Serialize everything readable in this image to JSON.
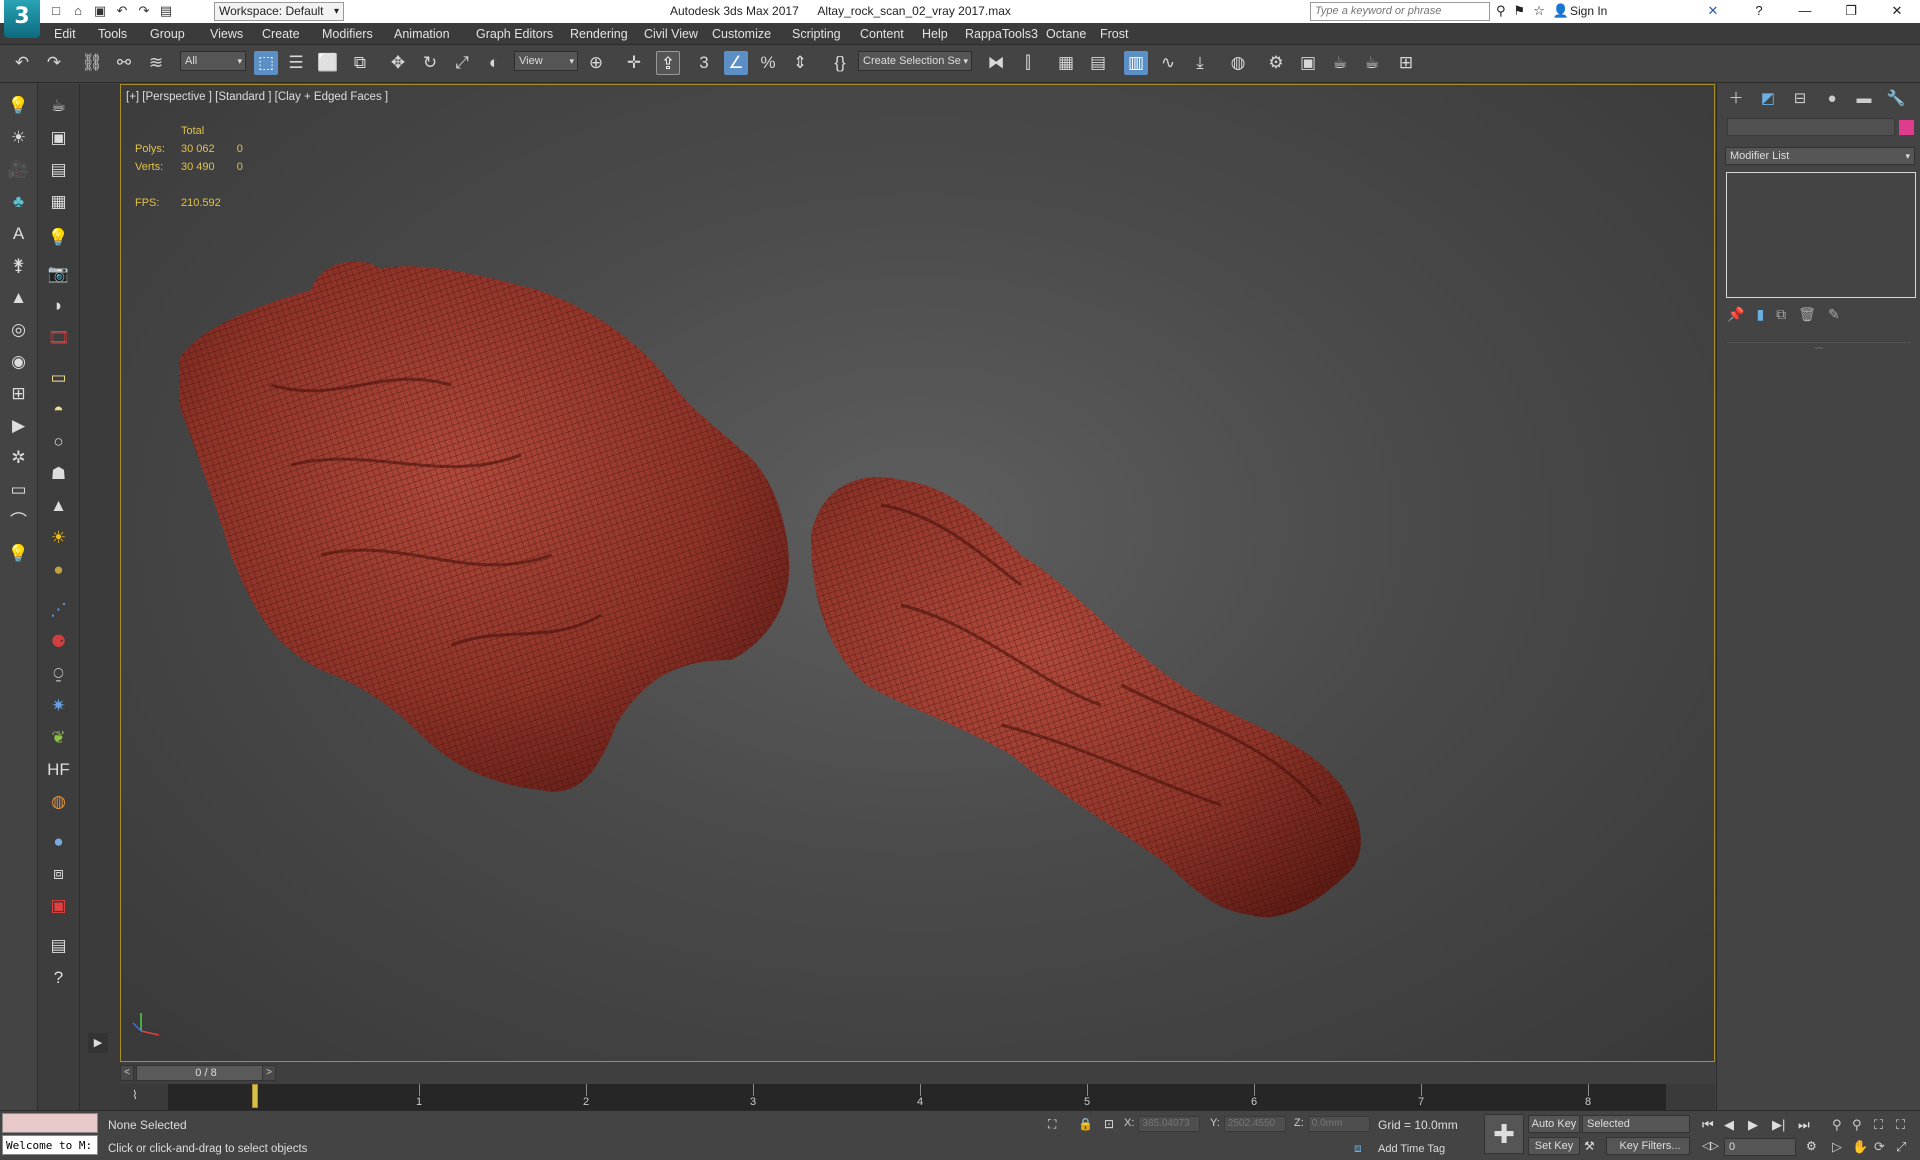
{
  "titlebar": {
    "app_title": "Autodesk 3ds Max 2017",
    "file_name": "Altay_rock_scan_02_vray 2017.max",
    "workspace": "Workspace: Default",
    "search_placeholder": "Type a keyword or phrase",
    "sign_in": "Sign In",
    "logo": "3"
  },
  "menu": [
    "Edit",
    "Tools",
    "Group",
    "Views",
    "Create",
    "Modifiers",
    "Animation",
    "Graph Editors",
    "Rendering",
    "Civil View",
    "Customize",
    "Scripting",
    "Content",
    "Help",
    "RappaTools3",
    "Octane",
    "Frost"
  ],
  "toolbar": {
    "filter": "All",
    "ref_coord": "View",
    "selection_set": "Create Selection Se"
  },
  "viewport": {
    "label": "[+] [Perspective ] [Standard ] [Clay + Edged Faces ]",
    "stats": {
      "total_label": "Total",
      "polys_label": "Polys:",
      "polys_total": "30 062",
      "polys_sel": "0",
      "verts_label": "Verts:",
      "verts_total": "30 490",
      "verts_sel": "0",
      "fps_label": "FPS:",
      "fps": "210.592"
    },
    "mesh_color": "#8e3328"
  },
  "command_panel": {
    "modifier_list": "Modifier List",
    "object_color": "#dd3d8c"
  },
  "timeslider": {
    "frame": "0 / 8",
    "ticks": [
      "1",
      "2",
      "3",
      "4",
      "5",
      "6",
      "7",
      "8"
    ]
  },
  "status": {
    "listener": "Welcome to M:",
    "selection": "None Selected",
    "prompt": "Click or click-and-drag to select objects",
    "x_label": "X:",
    "x_value": "385.04073",
    "y_label": "Y:",
    "y_value": "2502.4550",
    "z_label": "Z:",
    "z_value": "0.0mm",
    "grid": "Grid = 10.0mm",
    "add_time_tag": "Add Time Tag",
    "auto_key": "Auto Key",
    "set_key": "Set Key",
    "key_mode": "Selected",
    "key_filters": "Key Filters...",
    "current_frame": "0"
  }
}
